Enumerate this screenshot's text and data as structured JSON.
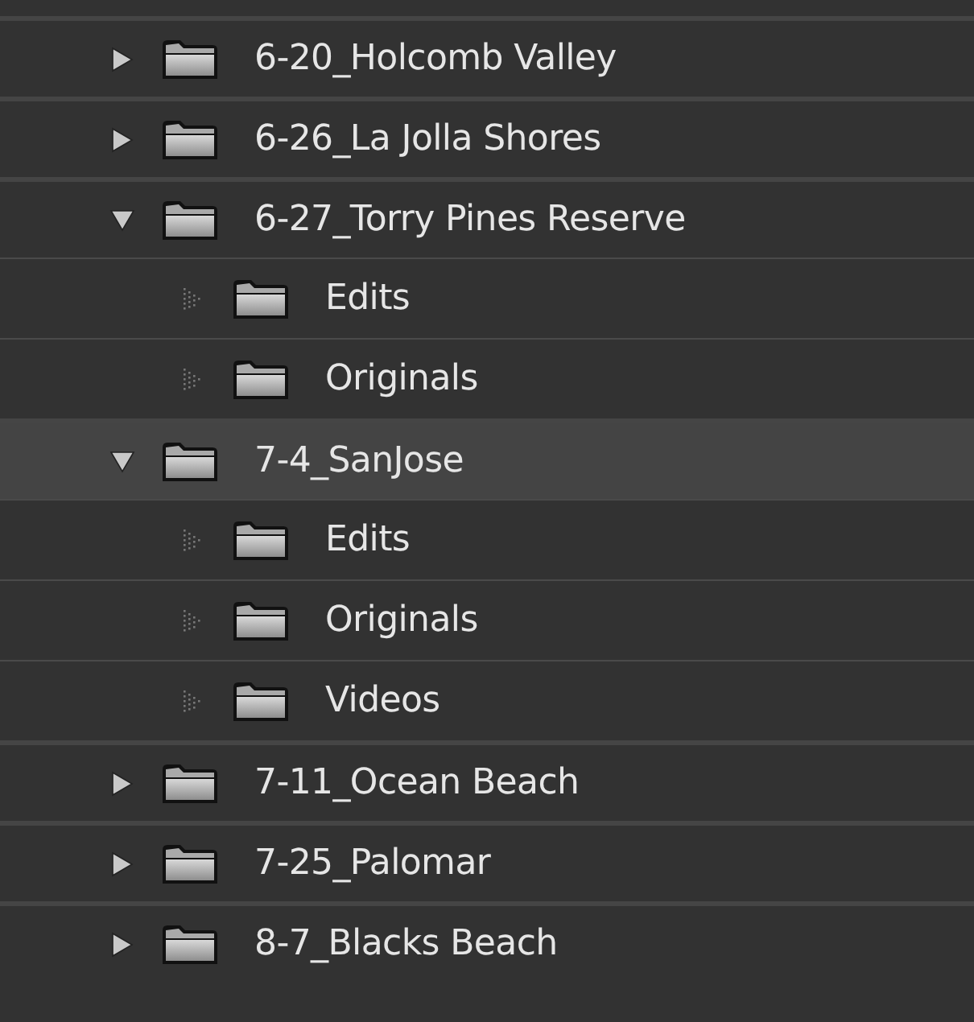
{
  "folders": [
    {
      "name": "6-20_Holcomb Valley",
      "expanded": false,
      "selected": false
    },
    {
      "name": "6-26_La Jolla Shores",
      "expanded": false,
      "selected": false
    },
    {
      "name": "6-27_Torry Pines Reserve",
      "expanded": true,
      "selected": false,
      "children": [
        {
          "name": "Edits",
          "selected": false
        },
        {
          "name": "Originals",
          "selected": false
        }
      ]
    },
    {
      "name": "7-4_SanJose",
      "expanded": true,
      "selected": true,
      "children": [
        {
          "name": "Edits",
          "selected": false
        },
        {
          "name": "Originals",
          "selected": false
        },
        {
          "name": "Videos",
          "selected": false
        }
      ]
    },
    {
      "name": "7-11_Ocean Beach",
      "expanded": false,
      "selected": false
    },
    {
      "name": "7-25_Palomar",
      "expanded": false,
      "selected": false
    },
    {
      "name": "8-7_Blacks Beach",
      "expanded": false,
      "selected": false
    }
  ]
}
